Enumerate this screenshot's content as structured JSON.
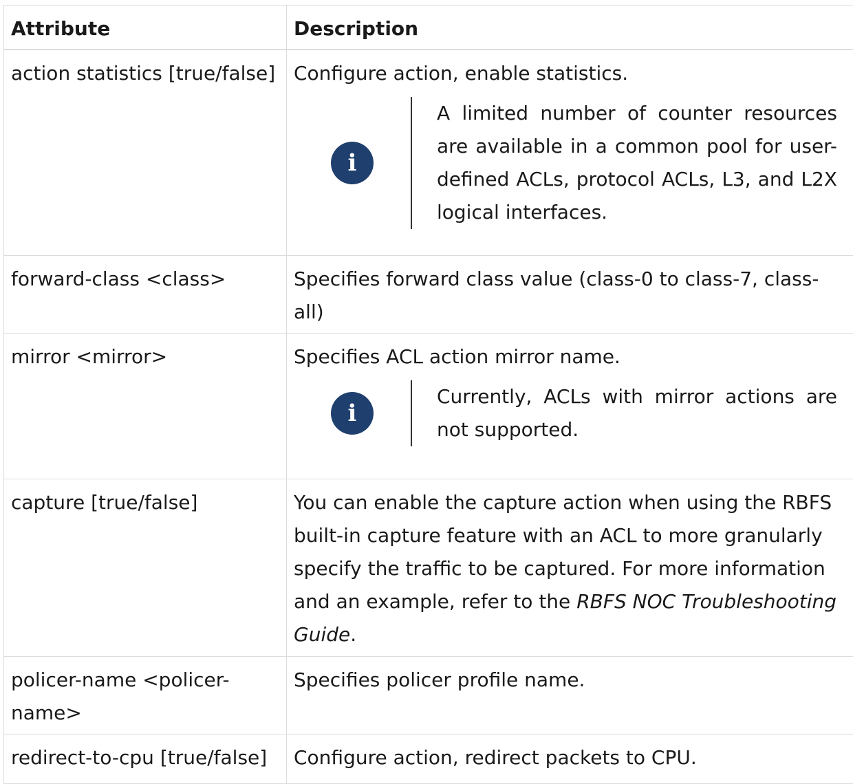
{
  "headers": {
    "attribute": "Attribute",
    "description": "Description"
  },
  "rows": [
    {
      "attribute": "action statistics [true/false]",
      "description": "Configure action, enable statistics.",
      "note": "A limited number of counter resources are available in a common pool for user-defined ACLs, protocol ACLs, L3, and L2X logical interfaces."
    },
    {
      "attribute": "forward-class <class>",
      "description": "Specifies forward class value (class-0 to class-7, class-all)"
    },
    {
      "attribute": "mirror <mirror>",
      "description": "Specifies ACL action mirror name.",
      "note": "Currently, ACLs with mirror actions are not supported."
    },
    {
      "attribute": "capture [true/false]",
      "description_pre": "You can enable the capture action when using the RBFS built-in capture feature with an ACL to more granularly specify the traffic to be captured. For more information and an example, refer to the ",
      "description_ref": "RBFS NOC Troubleshooting Guide",
      "description_post": "."
    },
    {
      "attribute": "policer-name <policer-name>",
      "description": "Specifies policer profile name."
    },
    {
      "attribute": "redirect-to-cpu [true/false]",
      "description": "Configure action, redirect packets to CPU."
    }
  ],
  "note_icon": "info-icon",
  "note_icon_glyph": "i",
  "colors": {
    "note_icon_bg": "#1f3f6e",
    "border": "#dcdcdc",
    "text": "#1a1a1a"
  }
}
